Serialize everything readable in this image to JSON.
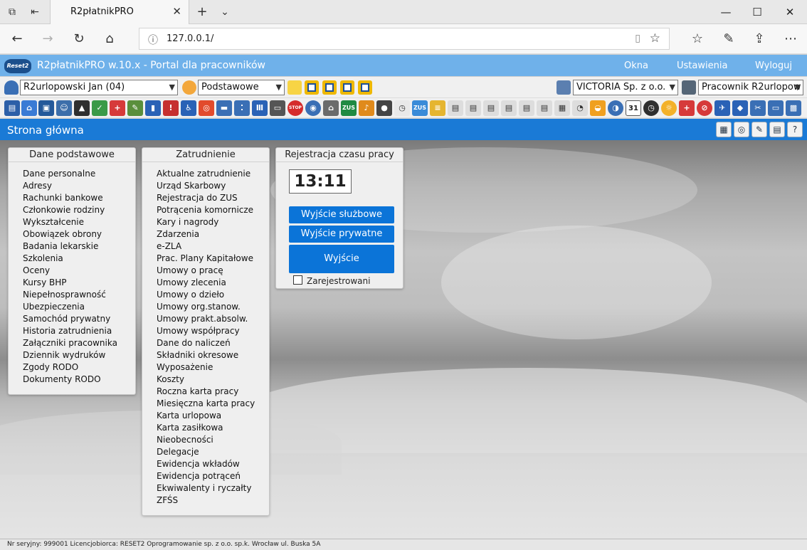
{
  "browser": {
    "tab_title": "R2płatnikPRO",
    "url": "127.0.0.1/"
  },
  "app": {
    "logo": "Reset2",
    "title": "R2płatnikPRO w.10.x - Portal dla pracowników",
    "links": [
      "Okna",
      "Ustawienia",
      "Wyloguj"
    ]
  },
  "selectors": {
    "employee": "R2urlopowski Jan (04)",
    "profile": "Podstawowe",
    "company": "VICTORIA Sp. z o.o.",
    "user": "Pracownik R2urlopow"
  },
  "toolbar": {
    "labels": {
      "zus": "ZUS",
      "zus2": "ZUS",
      "stop": "STOP",
      "calendar_day": "31"
    }
  },
  "page": {
    "title": "Strona główna"
  },
  "panels": {
    "basic": {
      "title": "Dane podstawowe",
      "items": [
        "Dane personalne",
        "Adresy",
        "Rachunki bankowe",
        "Członkowie rodziny",
        "Wykształcenie",
        "Obowiązek obrony",
        "Badania lekarskie",
        "Szkolenia",
        "Oceny",
        "Kursy BHP",
        "Niepełnosprawność",
        "Ubezpieczenia",
        "Samochód prywatny",
        "Historia zatrudnienia",
        "Załączniki pracownika",
        "Dziennik wydruków",
        "Zgody RODO",
        "Dokumenty RODO"
      ]
    },
    "employment": {
      "title": "Zatrudnienie",
      "items": [
        "Aktualne zatrudnienie",
        "Urząd Skarbowy",
        "Rejestracja do ZUS",
        "Potrącenia komornicze",
        "Kary i nagrody",
        "Zdarzenia",
        "e-ZLA",
        "Prac. Plany Kapitałowe",
        "Umowy o pracę",
        "Umowy zlecenia",
        "Umowy o dzieło",
        "Umowy org.stanow.",
        "Umowy prakt.absolw.",
        "Umowy współpracy",
        "Dane do naliczeń",
        "Składniki okresowe",
        "Wyposażenie",
        "Koszty",
        "Roczna karta pracy",
        "Miesięczna karta pracy",
        "Karta urlopowa",
        "Karta zasiłkowa",
        "Nieobecności",
        "Delegacje",
        "Ewidencja wkładów",
        "Ewidencja potrąceń",
        "Ekwiwalenty i ryczałty",
        "ZFŚS"
      ]
    },
    "time": {
      "title": "Rejestracja czasu pracy",
      "clock": "13:11",
      "btn_business": "Wyjście służbowe",
      "btn_private": "Wyjście prywatne",
      "btn_exit": "Wyjście",
      "registered_label": "Zarejestrowani"
    }
  },
  "status": "Nr seryjny: 999001 Licencjobiorca: RESET2 Oprogramowanie sp. z o.o. sp.k. Wrocław ul. Buska 5A",
  "colors": {
    "header": "#6fb1ea",
    "pagebar": "#1a7ad6",
    "button": "#0b74d8"
  }
}
